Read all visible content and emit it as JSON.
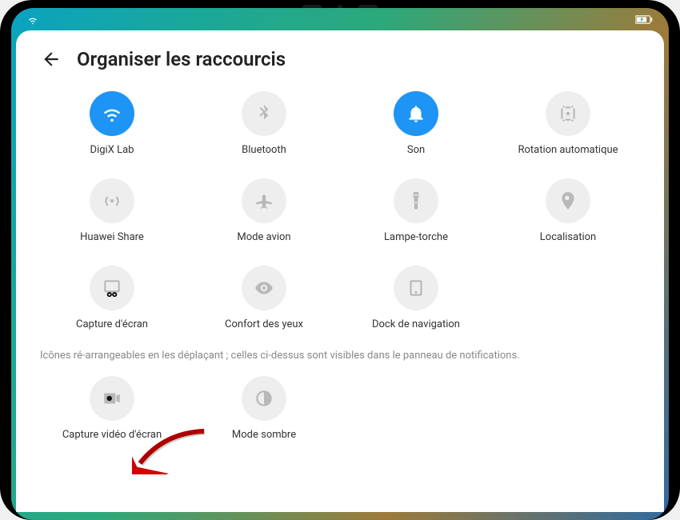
{
  "statusbar": {},
  "header": {
    "title": "Organiser les raccourcis"
  },
  "shortcuts_visible": [
    {
      "key": "wifi",
      "label": "DigiX Lab",
      "icon": "wifi",
      "active": true
    },
    {
      "key": "bluetooth",
      "label": "Bluetooth",
      "icon": "bluetooth",
      "active": false
    },
    {
      "key": "sound",
      "label": "Son",
      "icon": "bell",
      "active": true
    },
    {
      "key": "rotation",
      "label": "Rotation automatique",
      "icon": "rotate",
      "active": false
    },
    {
      "key": "huaweishare",
      "label": "Huawei Share",
      "icon": "broadcast",
      "active": false
    },
    {
      "key": "airplane",
      "label": "Mode avion",
      "icon": "airplane",
      "active": false
    },
    {
      "key": "torch",
      "label": "Lampe-torche",
      "icon": "flashlight",
      "active": false
    },
    {
      "key": "location",
      "label": "Localisation",
      "icon": "location",
      "active": false
    },
    {
      "key": "screenshot",
      "label": "Capture d'écran",
      "icon": "screenshot",
      "active": false
    },
    {
      "key": "eyecomfort",
      "label": "Confort des yeux",
      "icon": "eye",
      "active": false
    },
    {
      "key": "navdock",
      "label": "Dock de navigation",
      "icon": "dock",
      "active": false
    }
  ],
  "hint_text": "Icônes ré-arrangeables en les déplaçant ; celles ci-dessus sont visibles dans le panneau de notifications.",
  "shortcuts_hidden": [
    {
      "key": "screenrec",
      "label": "Capture vidéo d'écran",
      "icon": "videocam",
      "active": false
    },
    {
      "key": "darkmode",
      "label": "Mode sombre",
      "icon": "darkmode",
      "active": false
    }
  ]
}
